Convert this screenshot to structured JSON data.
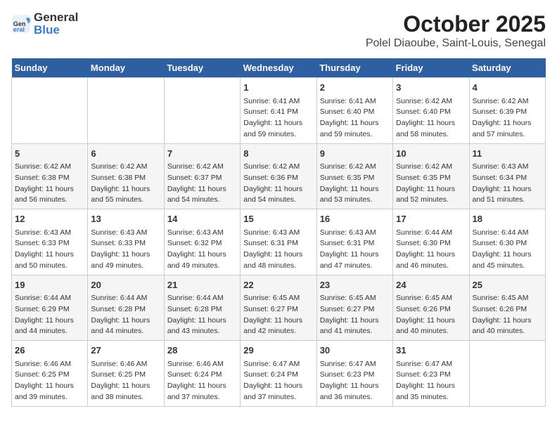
{
  "header": {
    "logo_general": "General",
    "logo_blue": "Blue",
    "month_title": "October 2025",
    "location": "Polel Diaoube, Saint-Louis, Senegal"
  },
  "days_of_week": [
    "Sunday",
    "Monday",
    "Tuesday",
    "Wednesday",
    "Thursday",
    "Friday",
    "Saturday"
  ],
  "weeks": [
    [
      {
        "day": "",
        "info": ""
      },
      {
        "day": "",
        "info": ""
      },
      {
        "day": "",
        "info": ""
      },
      {
        "day": "1",
        "info": "Sunrise: 6:41 AM\nSunset: 6:41 PM\nDaylight: 11 hours\nand 59 minutes."
      },
      {
        "day": "2",
        "info": "Sunrise: 6:41 AM\nSunset: 6:40 PM\nDaylight: 11 hours\nand 59 minutes."
      },
      {
        "day": "3",
        "info": "Sunrise: 6:42 AM\nSunset: 6:40 PM\nDaylight: 11 hours\nand 58 minutes."
      },
      {
        "day": "4",
        "info": "Sunrise: 6:42 AM\nSunset: 6:39 PM\nDaylight: 11 hours\nand 57 minutes."
      }
    ],
    [
      {
        "day": "5",
        "info": "Sunrise: 6:42 AM\nSunset: 6:38 PM\nDaylight: 11 hours\nand 56 minutes."
      },
      {
        "day": "6",
        "info": "Sunrise: 6:42 AM\nSunset: 6:38 PM\nDaylight: 11 hours\nand 55 minutes."
      },
      {
        "day": "7",
        "info": "Sunrise: 6:42 AM\nSunset: 6:37 PM\nDaylight: 11 hours\nand 54 minutes."
      },
      {
        "day": "8",
        "info": "Sunrise: 6:42 AM\nSunset: 6:36 PM\nDaylight: 11 hours\nand 54 minutes."
      },
      {
        "day": "9",
        "info": "Sunrise: 6:42 AM\nSunset: 6:35 PM\nDaylight: 11 hours\nand 53 minutes."
      },
      {
        "day": "10",
        "info": "Sunrise: 6:42 AM\nSunset: 6:35 PM\nDaylight: 11 hours\nand 52 minutes."
      },
      {
        "day": "11",
        "info": "Sunrise: 6:43 AM\nSunset: 6:34 PM\nDaylight: 11 hours\nand 51 minutes."
      }
    ],
    [
      {
        "day": "12",
        "info": "Sunrise: 6:43 AM\nSunset: 6:33 PM\nDaylight: 11 hours\nand 50 minutes."
      },
      {
        "day": "13",
        "info": "Sunrise: 6:43 AM\nSunset: 6:33 PM\nDaylight: 11 hours\nand 49 minutes."
      },
      {
        "day": "14",
        "info": "Sunrise: 6:43 AM\nSunset: 6:32 PM\nDaylight: 11 hours\nand 49 minutes."
      },
      {
        "day": "15",
        "info": "Sunrise: 6:43 AM\nSunset: 6:31 PM\nDaylight: 11 hours\nand 48 minutes."
      },
      {
        "day": "16",
        "info": "Sunrise: 6:43 AM\nSunset: 6:31 PM\nDaylight: 11 hours\nand 47 minutes."
      },
      {
        "day": "17",
        "info": "Sunrise: 6:44 AM\nSunset: 6:30 PM\nDaylight: 11 hours\nand 46 minutes."
      },
      {
        "day": "18",
        "info": "Sunrise: 6:44 AM\nSunset: 6:30 PM\nDaylight: 11 hours\nand 45 minutes."
      }
    ],
    [
      {
        "day": "19",
        "info": "Sunrise: 6:44 AM\nSunset: 6:29 PM\nDaylight: 11 hours\nand 44 minutes."
      },
      {
        "day": "20",
        "info": "Sunrise: 6:44 AM\nSunset: 6:28 PM\nDaylight: 11 hours\nand 44 minutes."
      },
      {
        "day": "21",
        "info": "Sunrise: 6:44 AM\nSunset: 6:28 PM\nDaylight: 11 hours\nand 43 minutes."
      },
      {
        "day": "22",
        "info": "Sunrise: 6:45 AM\nSunset: 6:27 PM\nDaylight: 11 hours\nand 42 minutes."
      },
      {
        "day": "23",
        "info": "Sunrise: 6:45 AM\nSunset: 6:27 PM\nDaylight: 11 hours\nand 41 minutes."
      },
      {
        "day": "24",
        "info": "Sunrise: 6:45 AM\nSunset: 6:26 PM\nDaylight: 11 hours\nand 40 minutes."
      },
      {
        "day": "25",
        "info": "Sunrise: 6:45 AM\nSunset: 6:26 PM\nDaylight: 11 hours\nand 40 minutes."
      }
    ],
    [
      {
        "day": "26",
        "info": "Sunrise: 6:46 AM\nSunset: 6:25 PM\nDaylight: 11 hours\nand 39 minutes."
      },
      {
        "day": "27",
        "info": "Sunrise: 6:46 AM\nSunset: 6:25 PM\nDaylight: 11 hours\nand 38 minutes."
      },
      {
        "day": "28",
        "info": "Sunrise: 6:46 AM\nSunset: 6:24 PM\nDaylight: 11 hours\nand 37 minutes."
      },
      {
        "day": "29",
        "info": "Sunrise: 6:47 AM\nSunset: 6:24 PM\nDaylight: 11 hours\nand 37 minutes."
      },
      {
        "day": "30",
        "info": "Sunrise: 6:47 AM\nSunset: 6:23 PM\nDaylight: 11 hours\nand 36 minutes."
      },
      {
        "day": "31",
        "info": "Sunrise: 6:47 AM\nSunset: 6:23 PM\nDaylight: 11 hours\nand 35 minutes."
      },
      {
        "day": "",
        "info": ""
      }
    ]
  ]
}
